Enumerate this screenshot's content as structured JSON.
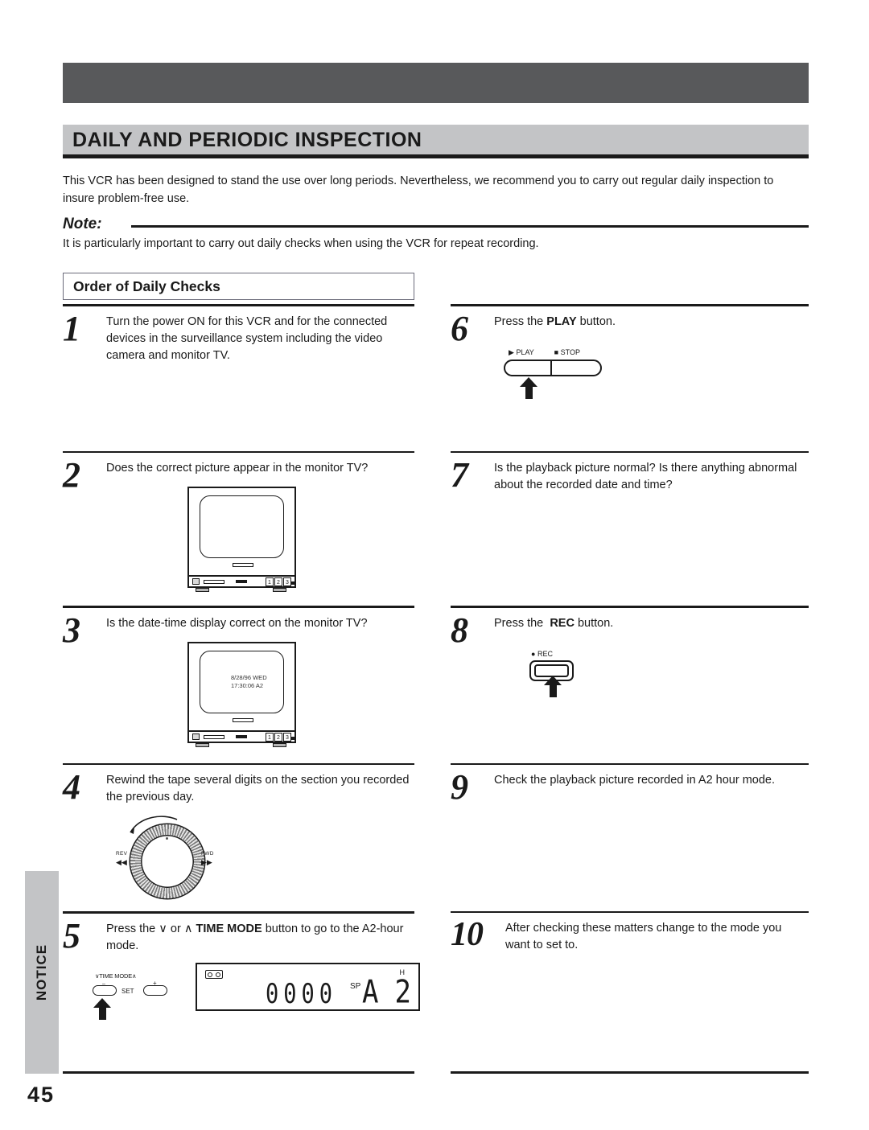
{
  "page": {
    "title": "DAILY AND PERIODIC INSPECTION",
    "intro": "This VCR has been designed to stand the use over long periods. Nevertheless, we recommend you to carry out regular daily inspection to insure problem-free use.",
    "page_number": "45",
    "side_tab": "NOTICE"
  },
  "note": {
    "label": "Note:",
    "body": "It is particularly important to carry out daily checks when using the VCR for repeat recording."
  },
  "section": {
    "heading": "Order of Daily Checks"
  },
  "steps": {
    "s1": {
      "number": "1",
      "text": "Turn the power ON for this VCR and for the connected devices in the surveillance system including the video camera and monitor TV."
    },
    "s2": {
      "number": "2",
      "text": "Does the correct picture appear in the monitor TV?"
    },
    "s3": {
      "number": "3",
      "text": "Is the date-time display correct on the monitor TV?",
      "osd_line1": "8/28/96 WED",
      "osd_line2": "17:30:06  A2"
    },
    "s4": {
      "number": "4",
      "text": "Rewind the tape several digits on the section you recorded the previous day."
    },
    "s5": {
      "number": "5",
      "text_a": "Press the ",
      "down_arrow": "∨",
      "text_b": " or ",
      "up_arrow": "∧",
      "bold": "TIME MODE",
      "text_c": " button to go to the A2-hour mode."
    },
    "s6": {
      "number": "6",
      "text_a": "Press the ",
      "bold": "PLAY",
      "text_b": " button."
    },
    "s7": {
      "number": "7",
      "text": "Is the playback picture normal? Is there anything abnormal about the recorded date and time?"
    },
    "s8": {
      "number": "8",
      "text_a": "Press the ",
      "bold": "REC",
      "text_b": " button."
    },
    "s9": {
      "number": "9",
      "text": "Check the playback picture recorded in A2 hour mode."
    },
    "s10": {
      "number": "10",
      "text": "After checking these matters change to the mode you want to set to."
    }
  },
  "figures": {
    "tv_buttons": [
      "1",
      "2",
      "3"
    ],
    "play_stop": {
      "play_icon": "▶",
      "play_label": "PLAY",
      "stop_icon": "■",
      "stop_label": "STOP"
    },
    "rec": {
      "icon": "●",
      "label": "REC"
    },
    "jog": {
      "rev_label": "REV",
      "rev_arrow": "◀◀",
      "fwd_label": "FWD",
      "fwd_arrow": "▶▶"
    },
    "time_mode": {
      "down": "∨",
      "label": "TIME MODE",
      "up": "∧",
      "minus": "–",
      "plus": "+",
      "set": "SET"
    },
    "lcd": {
      "counter": "0000",
      "speed": "SP",
      "mode_letter": "A",
      "mode_digit": "2",
      "hour_unit": "H"
    }
  },
  "colors": {
    "dark_bar": "#58595b",
    "band_gray": "#c3c4c6",
    "ink": "#1a1a1a"
  }
}
